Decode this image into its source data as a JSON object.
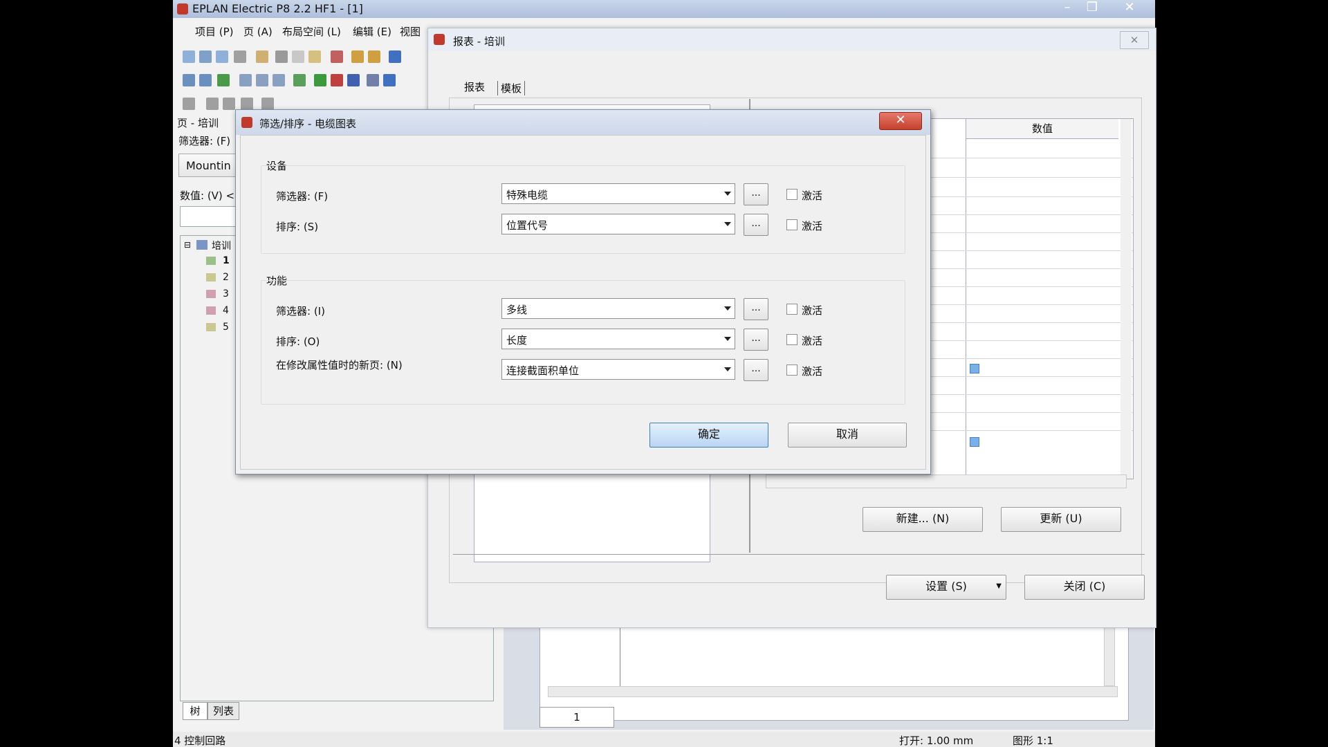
{
  "app": {
    "title": "EPLAN Electric P8 2.2 HF1 - [1]",
    "menu": [
      "项目 (P)",
      "页 (A)",
      "布局空间 (L)",
      "编辑 (E)",
      "视图"
    ],
    "page_panel_title": "页 - 培训",
    "filter_label": "筛选器: (F)",
    "filter_value": "Mountin",
    "value_label": "数值: (V) <",
    "tree_root": "培训",
    "tree_items": [
      "1",
      "2",
      "3",
      "4",
      "5"
    ],
    "bottom_tabs": [
      "树",
      "列表"
    ],
    "page_tab": "1",
    "status_left": "4 控制回路",
    "status_grid": "打开: 1.00 mm",
    "status_scale": "图形 1:1"
  },
  "report_dialog": {
    "title": "报表 - 培训",
    "tabs": [
      "报表",
      "模板"
    ],
    "column_header": "数值",
    "new_button": "新建... (N)",
    "update_button": "更新 (U)",
    "settings_button": "设置 (S)",
    "close_button": "关闭 (C)"
  },
  "filter_dialog": {
    "title": "筛选/排序 - 电缆图表",
    "device_group": "设备",
    "function_group": "功能",
    "device_rows": [
      {
        "label": "筛选器: (F)",
        "value": "特殊电缆",
        "dots": "...",
        "check": "激活"
      },
      {
        "label": "排序: (S)",
        "value": "位置代号",
        "dots": "...",
        "check": "激活"
      }
    ],
    "function_rows": [
      {
        "label": "筛选器: (I)",
        "value": "多线",
        "dots": "...",
        "check": "激活"
      },
      {
        "label": "排序: (O)",
        "value": "长度",
        "dots": "...",
        "check": "激活"
      },
      {
        "label": "在修改属性值时的新页: (N)",
        "value": "连接截面积单位",
        "dots": "...",
        "check": "激活"
      }
    ],
    "ok_button": "确定",
    "cancel_button": "取消"
  },
  "colors": {
    "titlebar": "#b9c9e2",
    "ok_button": "#cfe3f8",
    "close_red": "#d0503a"
  }
}
